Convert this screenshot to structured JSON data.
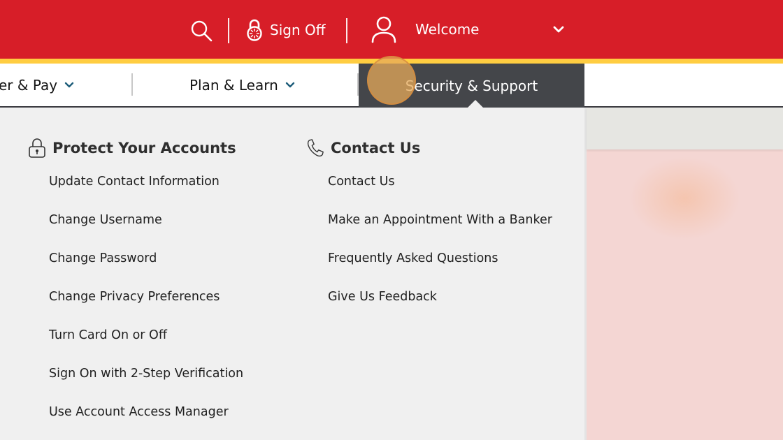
{
  "topbar": {
    "search_icon": "search-icon",
    "sign_off_label": "Sign Off",
    "sign_off_icon": "combination-lock-icon",
    "welcome_label": "Welcome",
    "user_icon": "user-icon",
    "chevron_icon": "chevron-down-icon"
  },
  "colors": {
    "brand_red": "#d71e28",
    "brand_gold": "#ffcd41",
    "active_tab": "#44464a"
  },
  "nav": {
    "items": [
      {
        "label": "er & Pay",
        "has_chevron": true
      },
      {
        "label": "Plan & Learn",
        "has_chevron": true
      },
      {
        "label": "Security & Support",
        "active": true
      }
    ]
  },
  "dropdown": {
    "columns": [
      {
        "heading": "Protect Your Accounts",
        "icon": "padlock-icon",
        "links": [
          "Update Contact Information",
          "Change Username",
          "Change Password",
          "Change Privacy Preferences",
          "Turn Card On or Off",
          "Sign On with 2-Step Verification",
          "Use Account Access Manager"
        ]
      },
      {
        "heading": "Contact Us",
        "icon": "phone-icon",
        "links": [
          "Contact Us",
          "Make an Appointment With a Banker",
          "Frequently Asked Questions",
          "Give Us Feedback"
        ]
      }
    ]
  }
}
